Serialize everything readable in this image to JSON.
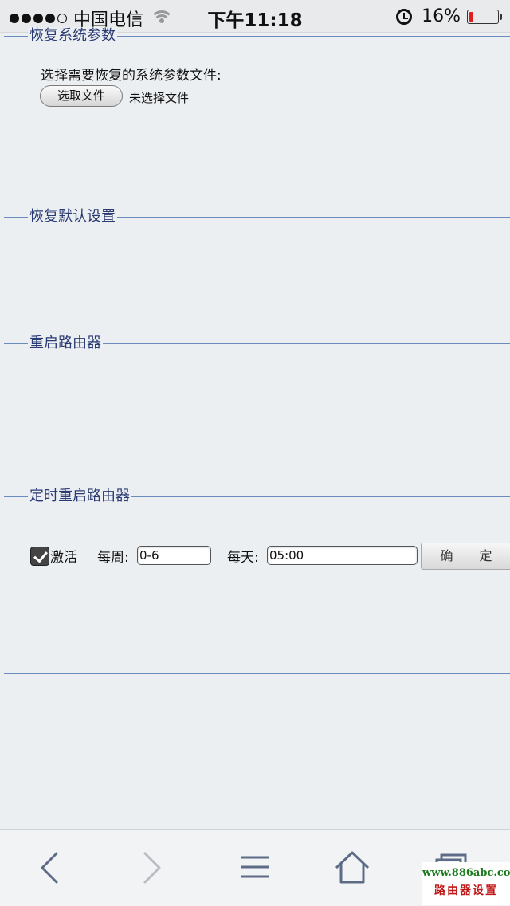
{
  "status_bar": {
    "carrier": "中国电信",
    "time": "下午11:18",
    "battery_percent": "16%",
    "battery_level": 0.16,
    "signal_bars_filled": 4,
    "signal_bars_total": 5,
    "icons": [
      "wifi-icon",
      "alarm-icon",
      "battery-icon"
    ]
  },
  "sections": {
    "restore_params": {
      "title": "恢复系统参数",
      "prompt": "选择需要恢复的系统参数文件:",
      "choose_file_label": "选取文件",
      "file_status": "未选择文件"
    },
    "restore_default": {
      "title": "恢复默认设置"
    },
    "reboot": {
      "title": "重启路由器"
    },
    "scheduled_reboot": {
      "title": "定时重启路由器",
      "activate_label": "激活",
      "activate_checked": true,
      "weekly_label": "每周:",
      "weekly_value": "0-6",
      "daily_label": "每天:",
      "daily_value": "05:00",
      "confirm_label": "确 定"
    }
  },
  "toolbar": {
    "icons": [
      "back-arrow-icon",
      "forward-arrow-icon",
      "menu-icon",
      "home-icon",
      "tabs-icon"
    ]
  },
  "watermark": {
    "url": "www.886abc.com",
    "text": "路由器设置"
  },
  "colors": {
    "background": "#eceff2",
    "section_line": "#6a8bbd",
    "section_title": "#2a3a72",
    "battery_low": "#e02020"
  }
}
